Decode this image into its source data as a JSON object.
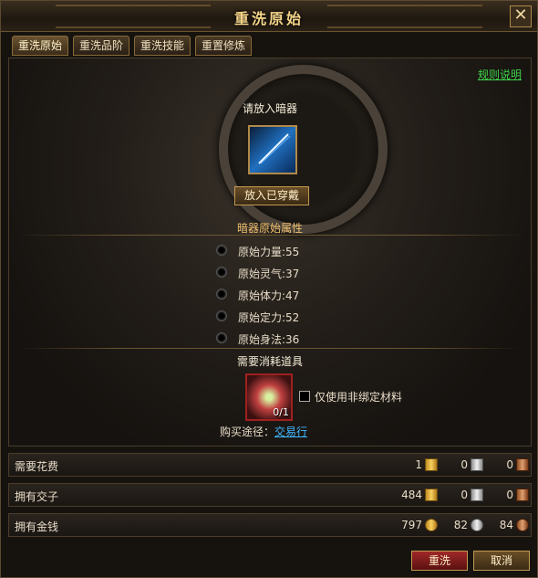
{
  "window": {
    "title": "重洗原始",
    "close": "✕"
  },
  "tabs": [
    {
      "label": "重洗原始",
      "active": true
    },
    {
      "label": "重洗品阶",
      "active": false
    },
    {
      "label": "重洗技能",
      "active": false
    },
    {
      "label": "重置修炼",
      "active": false
    }
  ],
  "rules_link": "规则说明",
  "slot": {
    "prompt": "请放入暗器",
    "put_button": "放入已穿戴",
    "item_icon": "needle-icon"
  },
  "attributes": {
    "heading": "暗器原始属性",
    "items": [
      {
        "label": "原始力量:55"
      },
      {
        "label": "原始灵气:37"
      },
      {
        "label": "原始体力:47"
      },
      {
        "label": "原始定力:52"
      },
      {
        "label": "原始身法:36"
      }
    ]
  },
  "consume": {
    "heading": "需要消耗道具",
    "count": "0/1",
    "checkbox_label": "仅使用非绑定材料",
    "buy_prefix": "购买途径：",
    "buy_link": "交易行"
  },
  "costs": [
    {
      "name": "需要花费",
      "v1": "1",
      "v2": "0",
      "v3": "0",
      "kind": "ingot"
    },
    {
      "name": "拥有交子",
      "v1": "484",
      "v2": "0",
      "v3": "0",
      "kind": "ingot"
    },
    {
      "name": "拥有金钱",
      "v1": "797",
      "v2": "82",
      "v3": "84",
      "kind": "coin"
    }
  ],
  "buttons": {
    "reroll": "重洗",
    "cancel": "取消"
  },
  "colors": {
    "accent": "#f4d48a",
    "link_green": "#3fd24a",
    "link_blue": "#3fb8ff",
    "reroll_red": "#a02828"
  }
}
